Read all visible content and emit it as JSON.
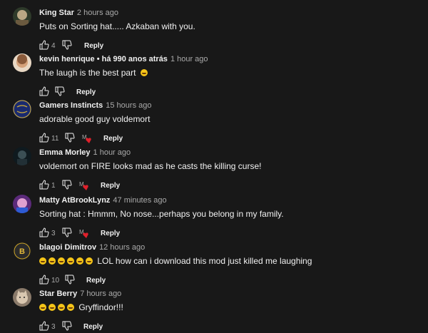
{
  "comments": [
    {
      "author": "King Star",
      "time": "2 hours ago",
      "text": "Puts on Sorting hat..... Azkaban with you.",
      "likes": "4",
      "reply": "Reply"
    },
    {
      "author": "kevin henrique • há 990 anos atrás",
      "time": "1 hour ago",
      "text": "The laugh is the best part",
      "likes": "",
      "reply": "Reply"
    },
    {
      "author": "Gamers Instincts",
      "time": "15 hours ago",
      "text": "adorable good guy voldemort",
      "likes": "11",
      "reply": "Reply"
    },
    {
      "author": "Emma Morley",
      "time": "1 hour ago",
      "text": "voldemort on FIRE looks mad as he casts the killing curse!",
      "likes": "1",
      "reply": "Reply"
    },
    {
      "author": "Matty AtBrookLynz",
      "time": "47 minutes ago",
      "text": "Sorting hat : Hmmm, No nose...perhaps you belong in my family.",
      "likes": "3",
      "reply": "Reply"
    },
    {
      "author": "blagoi Dimitrov",
      "time": "12 hours ago",
      "text": "LOL how can i download this mod just killed me laughing",
      "likes": "10",
      "reply": "Reply"
    },
    {
      "author": "Star Berry",
      "time": "7 hours ago",
      "text": "Gryffindor!!!",
      "likes": "3",
      "reply": "Reply"
    }
  ],
  "colors": {
    "background": "#181818",
    "heart": "#e0202b",
    "emoji": "#f5c518"
  },
  "icons": {
    "like": "thumbs-up-icon",
    "dislike": "thumbs-down-icon",
    "creator_heart": "creator-heart-icon"
  }
}
